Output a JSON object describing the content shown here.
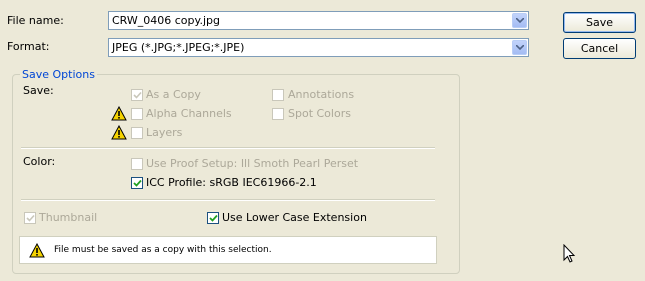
{
  "filename": {
    "label": "File name:",
    "value": "CRW_0406 copy.jpg"
  },
  "format": {
    "label": "Format:",
    "value": "JPEG (*.JPG;*.JPEG;*.JPE)"
  },
  "buttons": {
    "save": "Save",
    "cancel": "Cancel"
  },
  "save_options": {
    "legend": "Save Options",
    "save_label": "Save:",
    "as_a_copy": {
      "label": "As a Copy",
      "checked": true,
      "enabled": false
    },
    "alpha_channels": {
      "label": "Alpha Channels",
      "checked": false,
      "enabled": false
    },
    "layers": {
      "label": "Layers",
      "checked": false,
      "enabled": false
    },
    "annotations": {
      "label": "Annotations",
      "checked": false,
      "enabled": false
    },
    "spot_colors": {
      "label": "Spot Colors",
      "checked": false,
      "enabled": false
    },
    "color_label": "Color:",
    "use_proof_setup": {
      "label": "Use Proof Setup:  Ill Smoth Pearl Perset",
      "checked": false,
      "enabled": false
    },
    "icc_profile": {
      "label": "ICC Profile:  sRGB IEC61966-2.1",
      "checked": true,
      "enabled": true
    },
    "thumbnail": {
      "label": "Thumbnail",
      "checked": true,
      "enabled": false
    },
    "lower_case_ext": {
      "label": "Use Lower Case Extension",
      "checked": true,
      "enabled": true
    },
    "warning_message": "File must be saved as a copy with this selection."
  },
  "colors": {
    "accent": "#0046d5",
    "disabled_text": "#aca899",
    "check": "#21a121",
    "warning": "#f5d300"
  }
}
